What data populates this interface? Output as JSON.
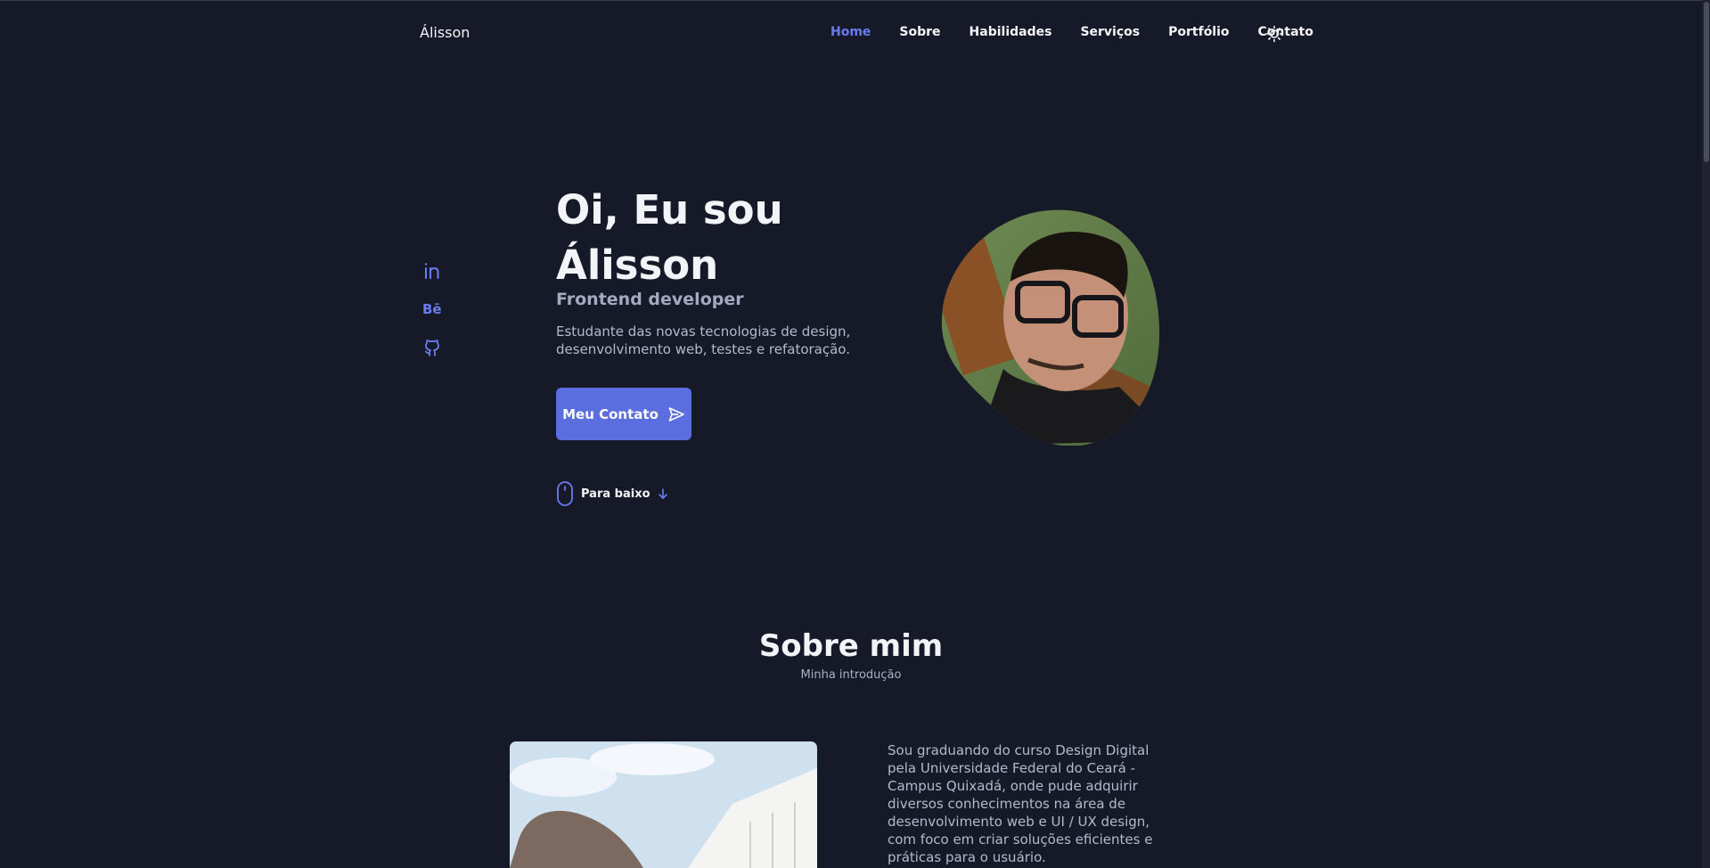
{
  "header": {
    "logo": "Álisson",
    "nav": [
      {
        "label": "Home",
        "active": true
      },
      {
        "label": "Sobre"
      },
      {
        "label": "Habilidades"
      },
      {
        "label": "Serviços"
      },
      {
        "label": "Portfólio"
      },
      {
        "label": "Contato"
      }
    ],
    "theme_icon": "sun-icon"
  },
  "socials": [
    {
      "icon": "linkedin-icon"
    },
    {
      "icon": "behance-icon",
      "label": "Bē"
    },
    {
      "icon": "github-icon"
    }
  ],
  "hero": {
    "title_line1": "Oi, Eu sou",
    "title_line2": "Álisson",
    "subtitle": "Frontend developer",
    "description": "Estudante das novas tecnologias de design, desenvolvimento web, testes e refatoração.",
    "cta_label": "Meu Contato",
    "cta_icon": "send-icon",
    "scroll_label": "Para baixo",
    "avatar_alt": "profile-photo"
  },
  "about": {
    "title": "Sobre mim",
    "subtitle": "Minha introdução",
    "text": "Sou graduando do curso Design Digital pela Universidade Federal do Ceará - Campus Quixadá, onde pude adquirir diversos conhecimentos na área de desenvolvimento web e UI / UX design, com foco em criar soluções eficientes e práticas para o usuário."
  },
  "colors": {
    "background": "#161927",
    "accent": "#5b6ee0",
    "accent_text": "#6b7bf0",
    "text": "#f3f4f8",
    "muted": "#b4b9cc"
  }
}
